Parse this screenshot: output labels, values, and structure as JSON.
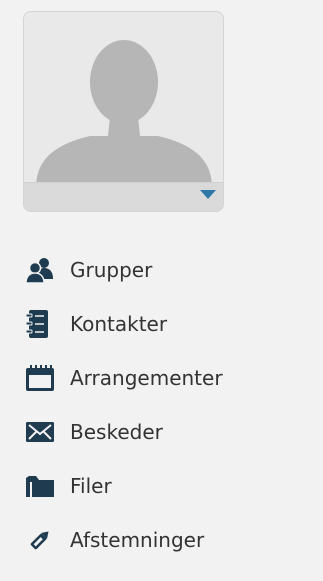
{
  "colors": {
    "icon": "#1f3b50",
    "accent": "#2f77a8",
    "text": "#333333",
    "avatar_silhouette": "#b6b6b6"
  },
  "profile": {
    "avatar_icon": "user-silhouette-icon",
    "menu_icon": "chevron-down-icon"
  },
  "nav": {
    "items": [
      {
        "label": "Grupper",
        "icon": "groups-icon"
      },
      {
        "label": "Kontakter",
        "icon": "address-book-icon"
      },
      {
        "label": "Arrangementer",
        "icon": "calendar-icon"
      },
      {
        "label": "Beskeder",
        "icon": "envelope-icon"
      },
      {
        "label": "Filer",
        "icon": "folder-icon"
      },
      {
        "label": "Afstemninger",
        "icon": "pencil-icon"
      }
    ]
  }
}
